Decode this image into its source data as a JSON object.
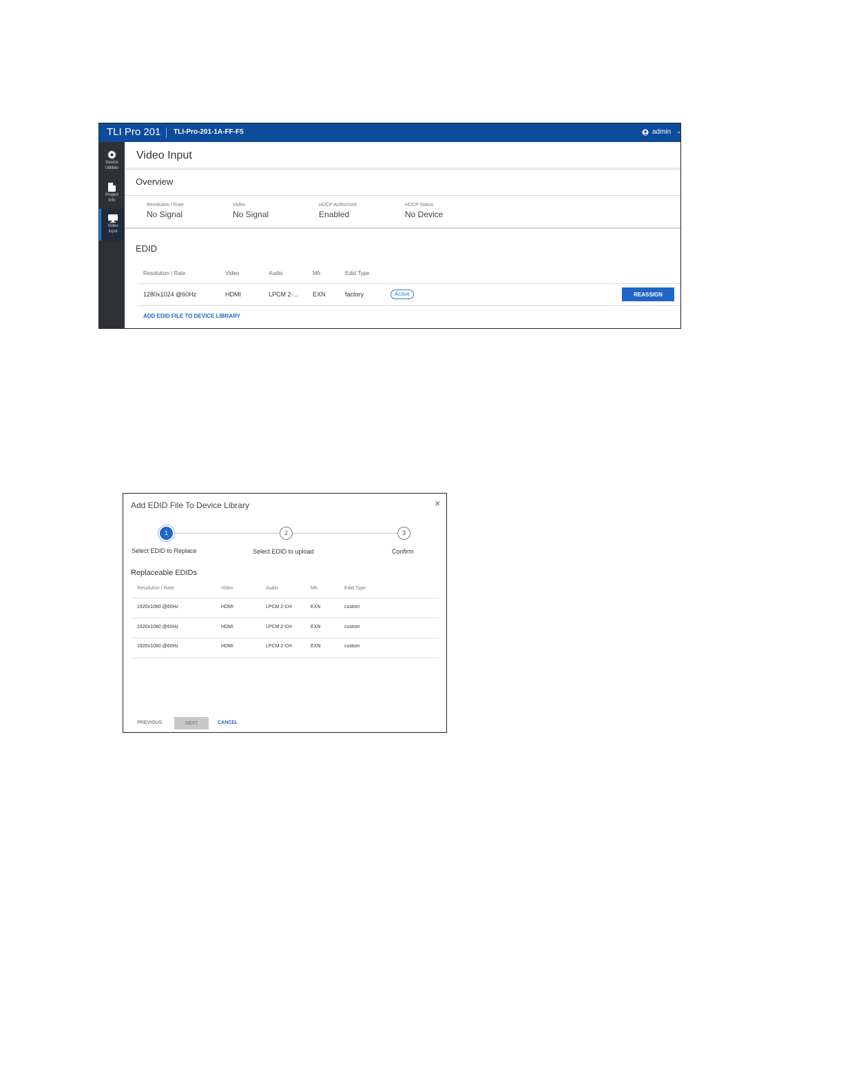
{
  "app": {
    "brand": "TLI Pro 201",
    "device_name": "TLI-Pro-201-1A-FF-F5",
    "user": "admin",
    "user_caret": "⌄",
    "sidebar": {
      "items": [
        {
          "label_line1": "Device",
          "label_line2": "Utilities",
          "icon": "gear-icon"
        },
        {
          "label_line1": "Project",
          "label_line2": "Info",
          "icon": "document-icon"
        },
        {
          "label_line1": "Video",
          "label_line2": "Input",
          "icon": "monitor-icon",
          "active": true
        }
      ]
    },
    "page_title": "Video Input",
    "overview": {
      "title": "Overview",
      "fields": [
        {
          "label": "Resolution / Rate",
          "value": "No Signal"
        },
        {
          "label": "Video",
          "value": "No Signal"
        },
        {
          "label": "HDCP Authorized",
          "value": "Enabled"
        },
        {
          "label": "HDCP Status",
          "value": "No Device"
        }
      ]
    },
    "edid": {
      "title": "EDID",
      "columns": [
        "Resolution / Rate",
        "Video",
        "Audio",
        "Mfr.",
        "Edid Type"
      ],
      "row": {
        "resolution": "1280x1024 @60Hz",
        "video": "HDMI",
        "audio": "LPCM 2-...",
        "mfr": "EXN",
        "edid_type": "factory",
        "status": "Active"
      },
      "reassign_label": "REASSIGN",
      "add_link": "ADD EDID FILE TO DEVICE LIBRARY"
    }
  },
  "dialog": {
    "title": "Add EDID File To Device Library",
    "close_glyph": "×",
    "steps": [
      {
        "number": "1",
        "label": "Select EDID to Replace"
      },
      {
        "number": "2",
        "label": "Select EDID to upload"
      },
      {
        "number": "3",
        "label": "Confirm"
      }
    ],
    "section_title": "Replaceable EDIDs",
    "columns": [
      "Resolution / Rate",
      "Video",
      "Audio",
      "Mfr.",
      "Edid Type"
    ],
    "rows": [
      {
        "resolution": "1920x1080 @60Hz",
        "video": "HDMI",
        "audio": "LPCM 2-CH",
        "mfr": "EXN",
        "edid_type": "custom"
      },
      {
        "resolution": "1920x1080 @60Hz",
        "video": "HDMI",
        "audio": "LPCM 2-CH",
        "mfr": "EXN",
        "edid_type": "custom"
      },
      {
        "resolution": "1920x1080 @60Hz",
        "video": "HDMI",
        "audio": "LPCM 2-CH",
        "mfr": "EXN",
        "edid_type": "custom"
      }
    ],
    "buttons": {
      "previous": "PREVIOUS",
      "next": "NEXT",
      "cancel": "CANCEL"
    }
  },
  "colors": {
    "brand_blue": "#0d4b9b",
    "accent_blue": "#1f66c6",
    "sidebar_bg": "#2e3135"
  }
}
